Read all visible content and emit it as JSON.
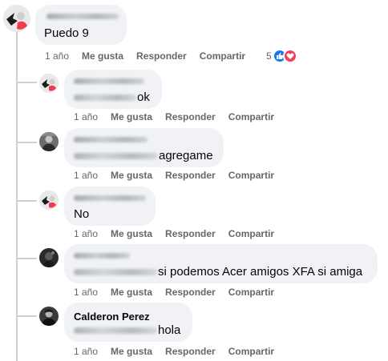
{
  "colors": {
    "like_blue": "#1877f2",
    "love_red": "#f33e58",
    "muted": "#65676b",
    "bubble": "#f0f2f5"
  },
  "actions": {
    "time": "1 año",
    "like": "Me gusta",
    "reply": "Responder",
    "share": "Compartir"
  },
  "main_comment": {
    "text": "Puedo 9",
    "reaction_count": "5",
    "reaction_icons": [
      "like-icon",
      "love-icon"
    ]
  },
  "replies": [
    {
      "text": "ok"
    },
    {
      "text": "agregame"
    },
    {
      "text": "No"
    },
    {
      "text": "si podemos Acer amigos XFA si amiga"
    },
    {
      "author": "Calderon Perez",
      "text": "hola"
    }
  ]
}
